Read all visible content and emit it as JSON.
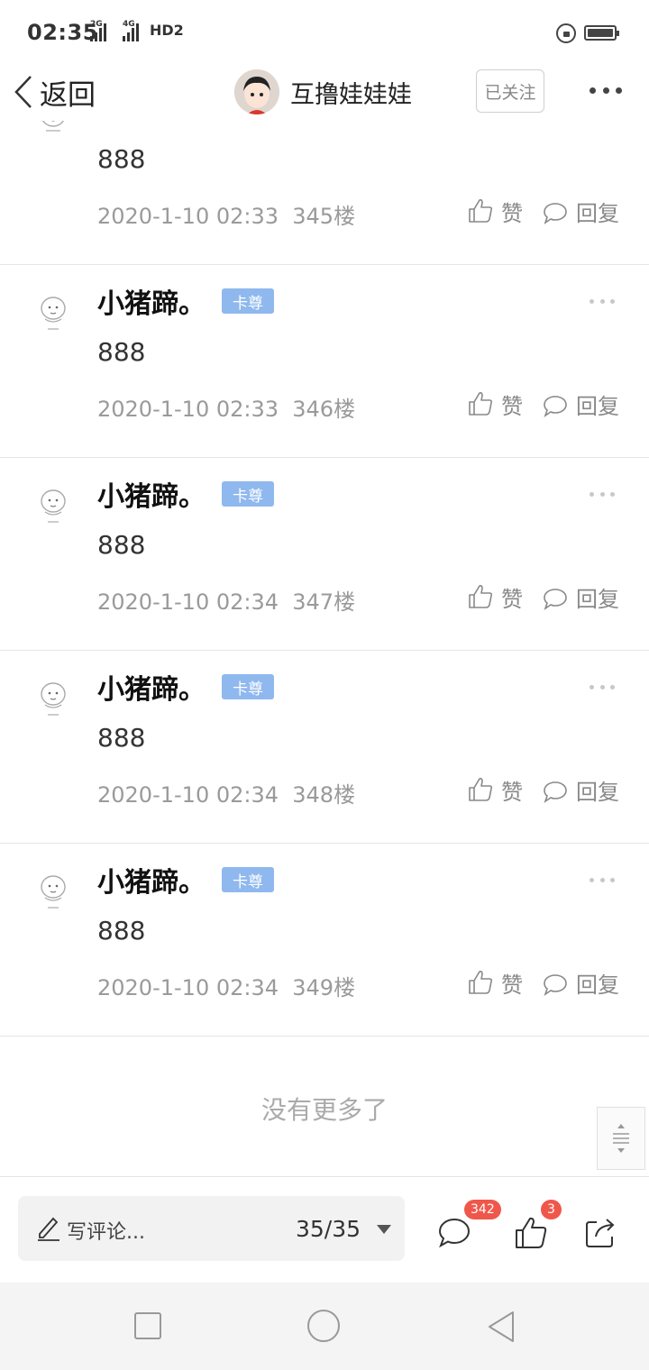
{
  "status_bar": {
    "time": "02:35",
    "sig1": "2G",
    "sig2": "4G",
    "hd": "HD2"
  },
  "header": {
    "back_label": "返回",
    "username": "互撸娃娃娃",
    "follow_label": "已关注"
  },
  "posts": [
    {
      "text": "888",
      "date": "2020-1-10 02:33",
      "floor": "345楼"
    },
    {
      "username": "小猪蹄。",
      "badge": "卡尊",
      "text": "888",
      "date": "2020-1-10 02:33",
      "floor": "346楼"
    },
    {
      "username": "小猪蹄。",
      "badge": "卡尊",
      "text": "888",
      "date": "2020-1-10 02:34",
      "floor": "347楼"
    },
    {
      "username": "小猪蹄。",
      "badge": "卡尊",
      "text": "888",
      "date": "2020-1-10 02:34",
      "floor": "348楼"
    },
    {
      "username": "小猪蹄。",
      "badge": "卡尊",
      "text": "888",
      "date": "2020-1-10 02:34",
      "floor": "349楼"
    }
  ],
  "actions": {
    "like_label": "赞",
    "reply_label": "回复"
  },
  "footer": {
    "no_more": "没有更多了"
  },
  "bottom_bar": {
    "comment_placeholder": "写评论...",
    "page_indicator": "35/35",
    "comment_count": "342",
    "like_count": "3"
  },
  "icons": {
    "back": "chevron-left-icon",
    "more": "more-dots-icon",
    "like": "thumb-up-icon",
    "reply": "speech-bubble-icon",
    "share": "share-icon",
    "edit": "pencil-icon"
  }
}
